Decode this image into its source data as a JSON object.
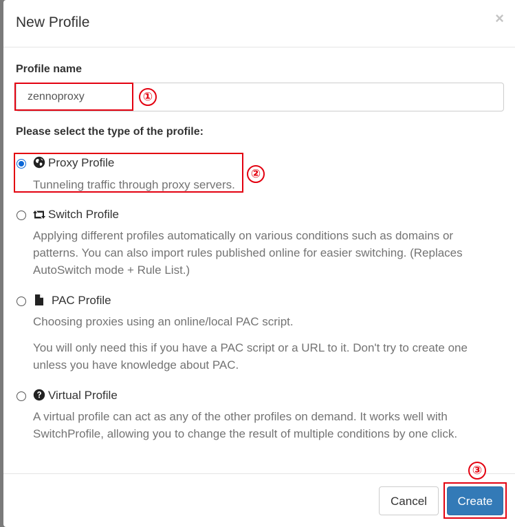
{
  "dialog": {
    "title": "New Profile",
    "close_symbol": "×"
  },
  "profile_name": {
    "label": "Profile name",
    "value": "zennoproxy"
  },
  "type_section": {
    "label": "Please select the type of the profile:",
    "options": [
      {
        "title": "Proxy Profile",
        "icon": "globe-icon",
        "selected": true,
        "description": [
          "Tunneling traffic through proxy servers."
        ]
      },
      {
        "title": "Switch Profile",
        "icon": "retweet-icon",
        "selected": false,
        "description": [
          "Applying different profiles automatically on various conditions such as domains or patterns. You can also import rules published online for easier switching. (Replaces AutoSwitch mode + Rule List.)"
        ]
      },
      {
        "title": "PAC Profile",
        "icon": "file-icon",
        "selected": false,
        "description": [
          "Choosing proxies using an online/local PAC script.",
          "You will only need this if you have a PAC script or a URL to it. Don't try to create one unless you have knowledge about PAC."
        ]
      },
      {
        "title": "Virtual Profile",
        "icon": "question-sign-icon",
        "selected": false,
        "description": [
          "A virtual profile can act as any of the other profiles on demand. It works well with SwitchProfile, allowing you to change the result of multiple conditions by one click."
        ]
      }
    ]
  },
  "footer": {
    "cancel_label": "Cancel",
    "create_label": "Create"
  },
  "annotations": {
    "marker_1": "①",
    "marker_2": "②",
    "marker_3": "③"
  },
  "colors": {
    "accent_blue": "#337ab7",
    "annotation_red": "#e3000f",
    "radio_blue": "#0a66d6"
  }
}
